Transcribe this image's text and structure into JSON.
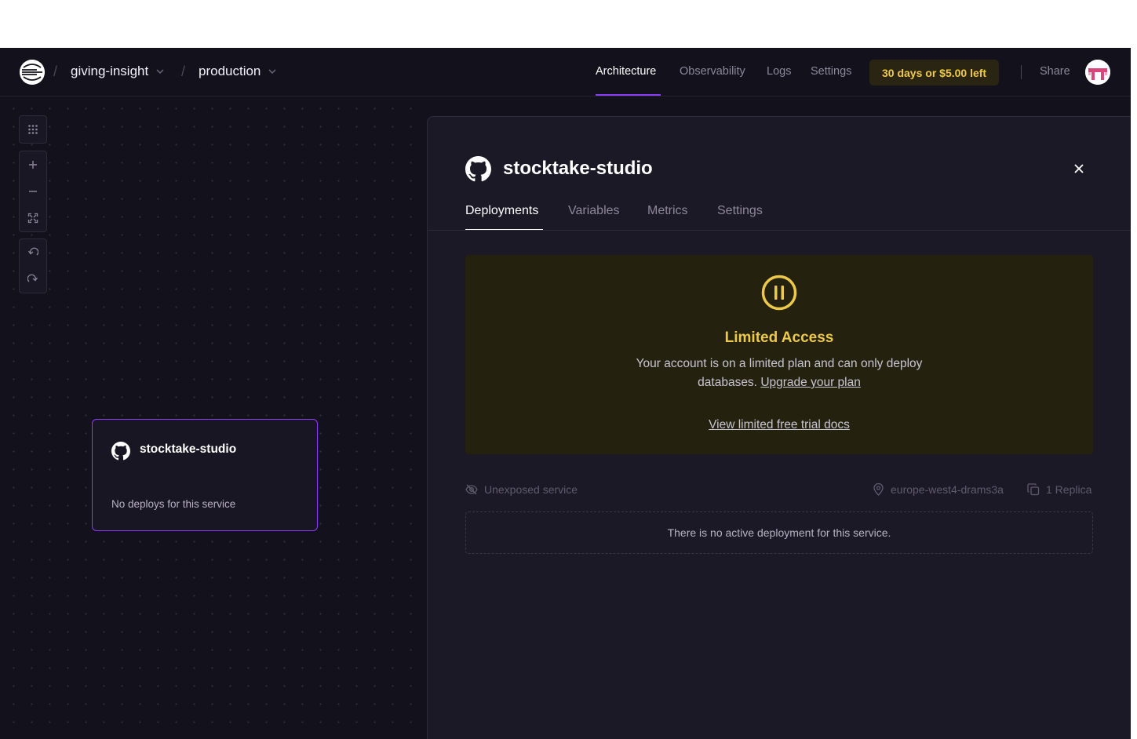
{
  "navbar": {
    "project": "giving-insight",
    "environment": "production",
    "links": [
      "Architecture",
      "Observability",
      "Logs",
      "Settings"
    ],
    "active_link": "Architecture",
    "trial_badge": "30 days or $5.00 left",
    "share": "Share"
  },
  "canvas": {
    "tools": [
      "grid-icon",
      "zoom-in-icon",
      "zoom-out-icon",
      "fit-screen-icon",
      "undo-icon",
      "redo-icon"
    ],
    "service_card": {
      "name": "stocktake-studio",
      "status": "No deploys for this service"
    }
  },
  "panel": {
    "title": "stocktake-studio",
    "tabs": [
      "Deployments",
      "Variables",
      "Metrics",
      "Settings"
    ],
    "active_tab": "Deployments",
    "limited": {
      "title": "Limited Access",
      "text": "Your account is on a limited plan and can only deploy databases.",
      "upgrade_link": "Upgrade your plan",
      "docs_link": "View limited free trial docs"
    },
    "meta": {
      "exposure": "Unexposed service",
      "region": "europe-west4-drams3a",
      "replicas": "1 Replica"
    },
    "empty_message": "There is no active deployment for this service."
  },
  "colors": {
    "background": "#13111c",
    "accent": "#8b3cf5",
    "warning": "#ecc94b"
  }
}
